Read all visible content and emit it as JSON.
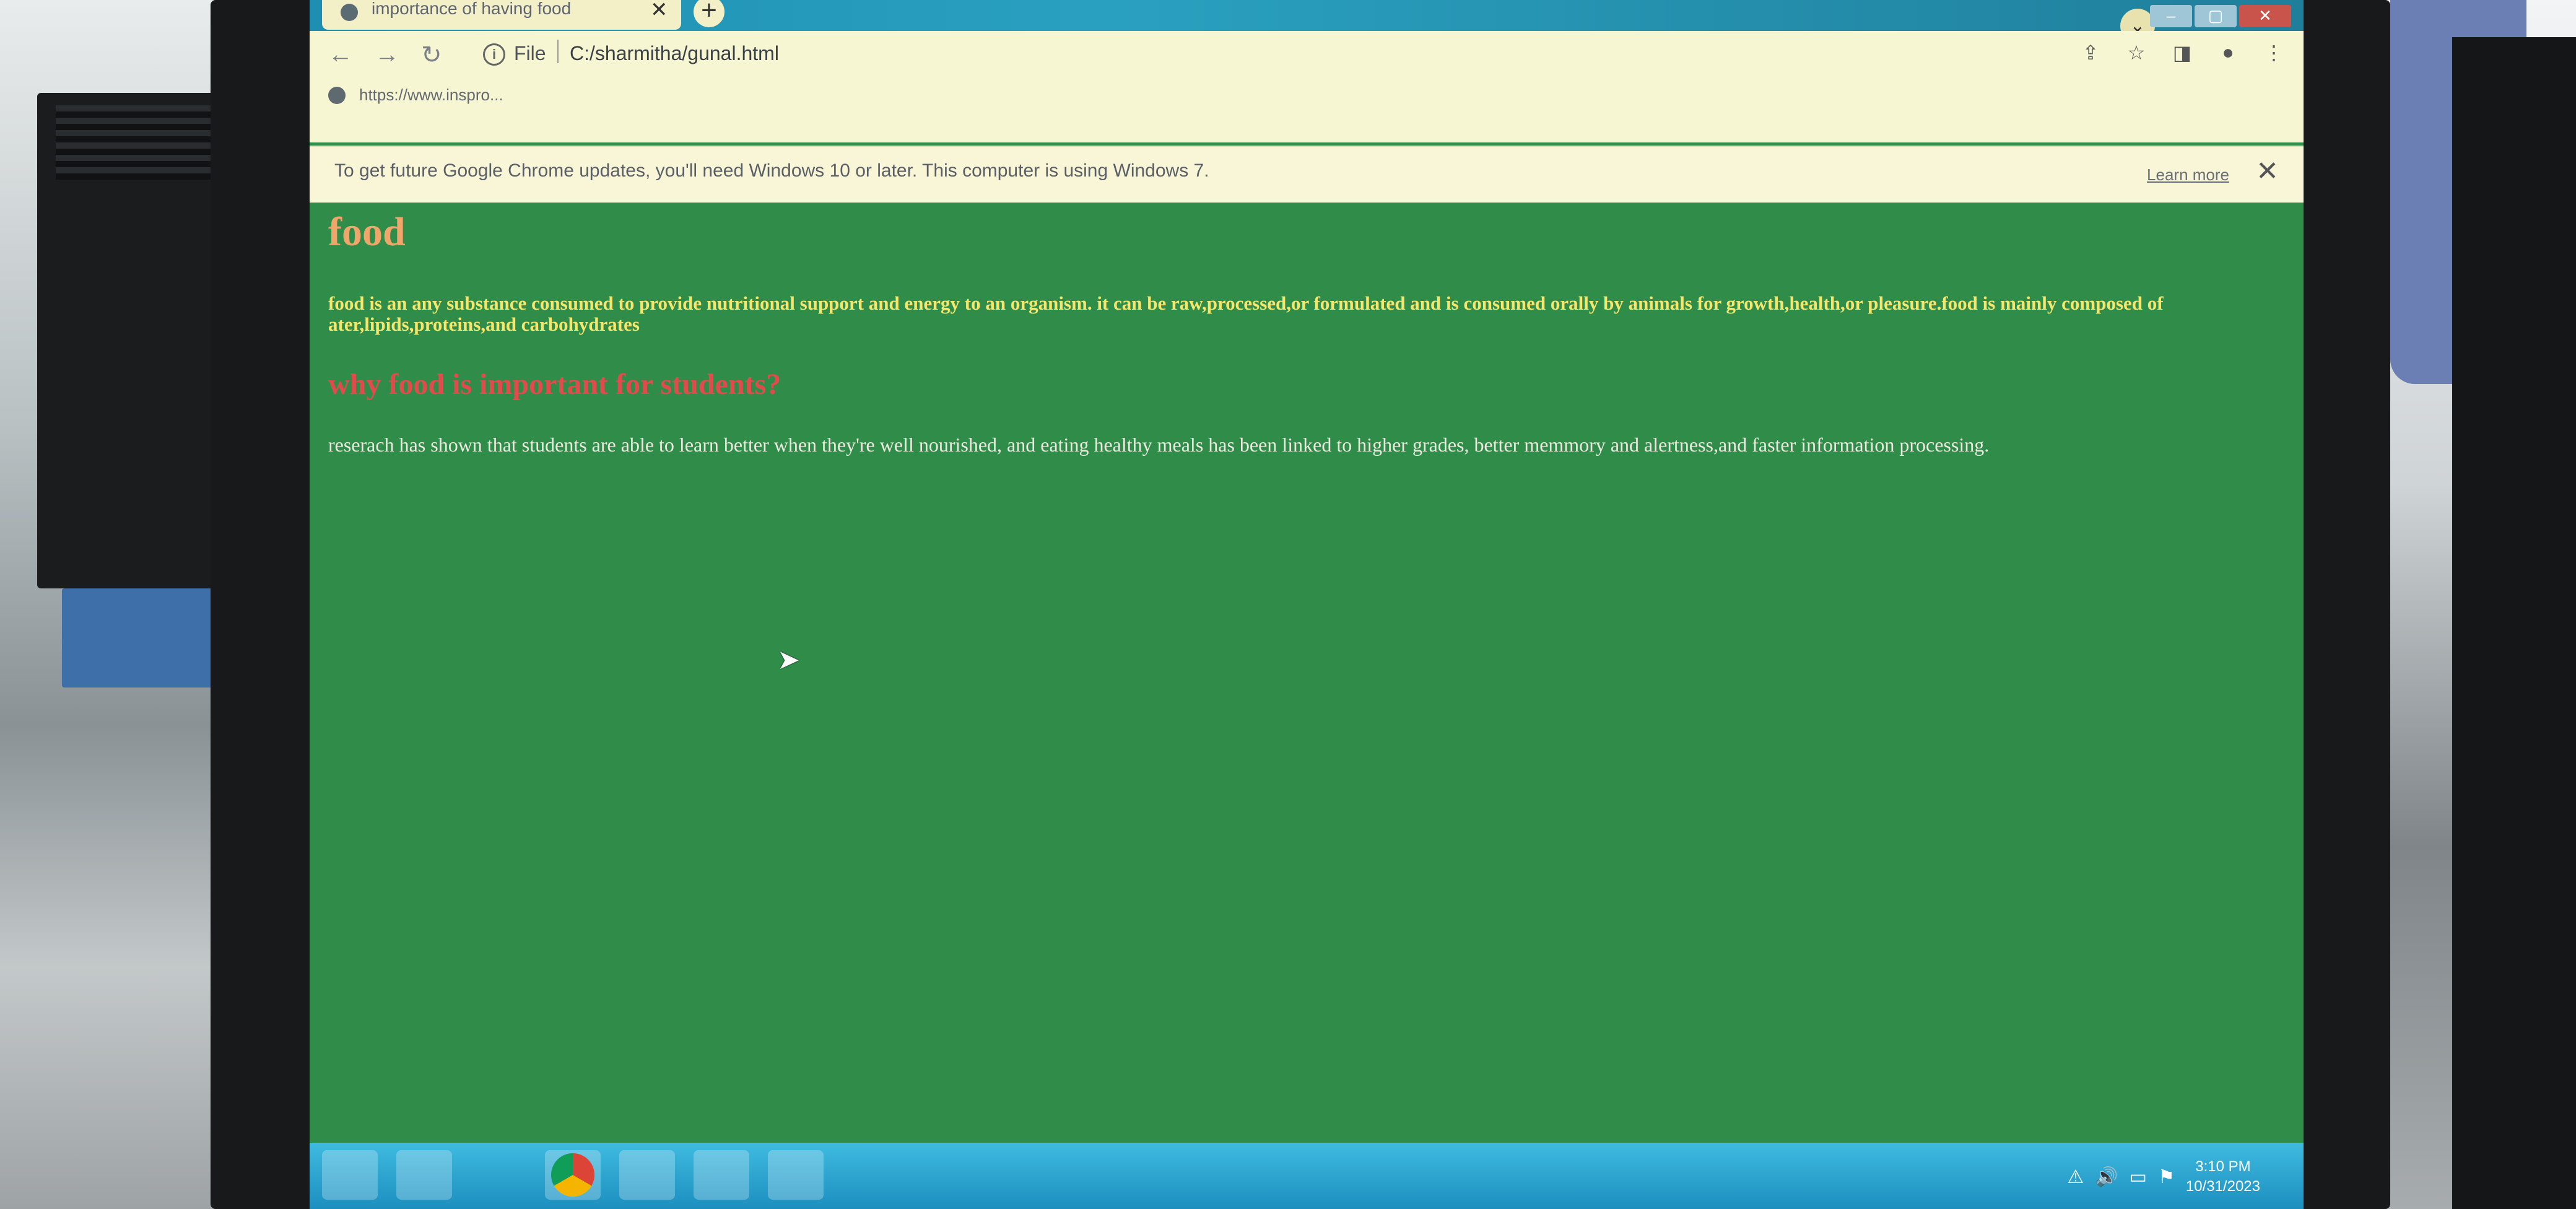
{
  "browser": {
    "tab_title": "importance of having food",
    "tab_close": "✕",
    "new_tab": "+",
    "url_scheme": "File",
    "url": "C:/sharmitha/gunal.html",
    "bookmark_label": "https://www.inspro...",
    "infobar_text": "To get future Google Chrome updates, you'll need Windows 10 or later. This computer is using Windows 7.",
    "learn_more": "Learn more",
    "infobar_close": "✕"
  },
  "page": {
    "heading": "food",
    "paragraph1": "food is an any substance consumed to provide nutritional support and energy to an organism. it can be raw,processed,or formulated and is consumed orally by animals for growth,health,or pleasure.food is mainly composed of ater,lipids,proteins,and carbohydrates",
    "subheading": "why food is important for students?",
    "paragraph2": "reserach has shown that students are able to learn better when they're well nourished, and eating healthy meals has been linked to higher grades, better memmory and alertness,and faster information processing.",
    "background_color": "#2f8d49",
    "heading_color": "#f1a56a",
    "paragraph1_color": "#f5e66d",
    "subheading_color": "#e24b4b"
  },
  "taskbar": {
    "time": "3:10 PM",
    "date": "10/31/2023"
  }
}
